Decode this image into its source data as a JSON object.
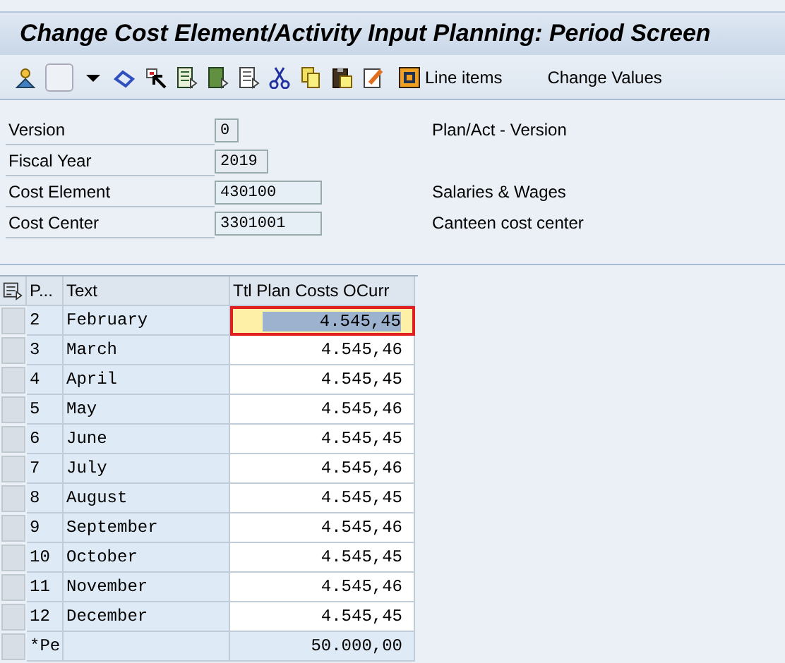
{
  "window": {
    "title": "Change Cost Element/Activity Input Planning: Period Screen"
  },
  "toolbar": {
    "buttons": [
      {
        "label": "Line items",
        "kind": "icon"
      },
      {
        "label": "Change Values",
        "kind": "text"
      }
    ]
  },
  "header_fields": [
    {
      "label": "Version",
      "value": "0",
      "kind": "display",
      "description": "Plan/Act - Version"
    },
    {
      "label": "Fiscal Year",
      "value": "2019",
      "kind": "display"
    },
    {
      "label": "Cost Element",
      "value": "430100",
      "kind": "input",
      "description": "Salaries & Wages"
    },
    {
      "label": "Cost Center",
      "value": "3301001",
      "kind": "input",
      "description": "Canteen cost center"
    }
  ],
  "table": {
    "columns": [
      "P...",
      "Text",
      "Ttl Plan Costs OCurr"
    ],
    "rows": [
      {
        "period": "2",
        "text": "February",
        "value": "4.545,45",
        "selected": true
      },
      {
        "period": "3",
        "text": "March",
        "value": "4.545,46",
        "selected": false
      },
      {
        "period": "4",
        "text": "April",
        "value": "4.545,45",
        "selected": false
      },
      {
        "period": "5",
        "text": "May",
        "value": "4.545,46",
        "selected": false
      },
      {
        "period": "6",
        "text": "June",
        "value": "4.545,45",
        "selected": false
      },
      {
        "period": "7",
        "text": "July",
        "value": "4.545,46",
        "selected": false
      },
      {
        "period": "8",
        "text": "August",
        "value": "4.545,45",
        "selected": false
      },
      {
        "period": "9",
        "text": "September",
        "value": "4.545,46",
        "selected": false
      },
      {
        "period": "10",
        "text": "October",
        "value": "4.545,45",
        "selected": false
      },
      {
        "period": "11",
        "text": "November",
        "value": "4.545,46",
        "selected": false
      },
      {
        "period": "12",
        "text": "December",
        "value": "4.545,45",
        "selected": false
      }
    ],
    "total": {
      "period": "*Pe",
      "value": "50.000,00"
    }
  }
}
